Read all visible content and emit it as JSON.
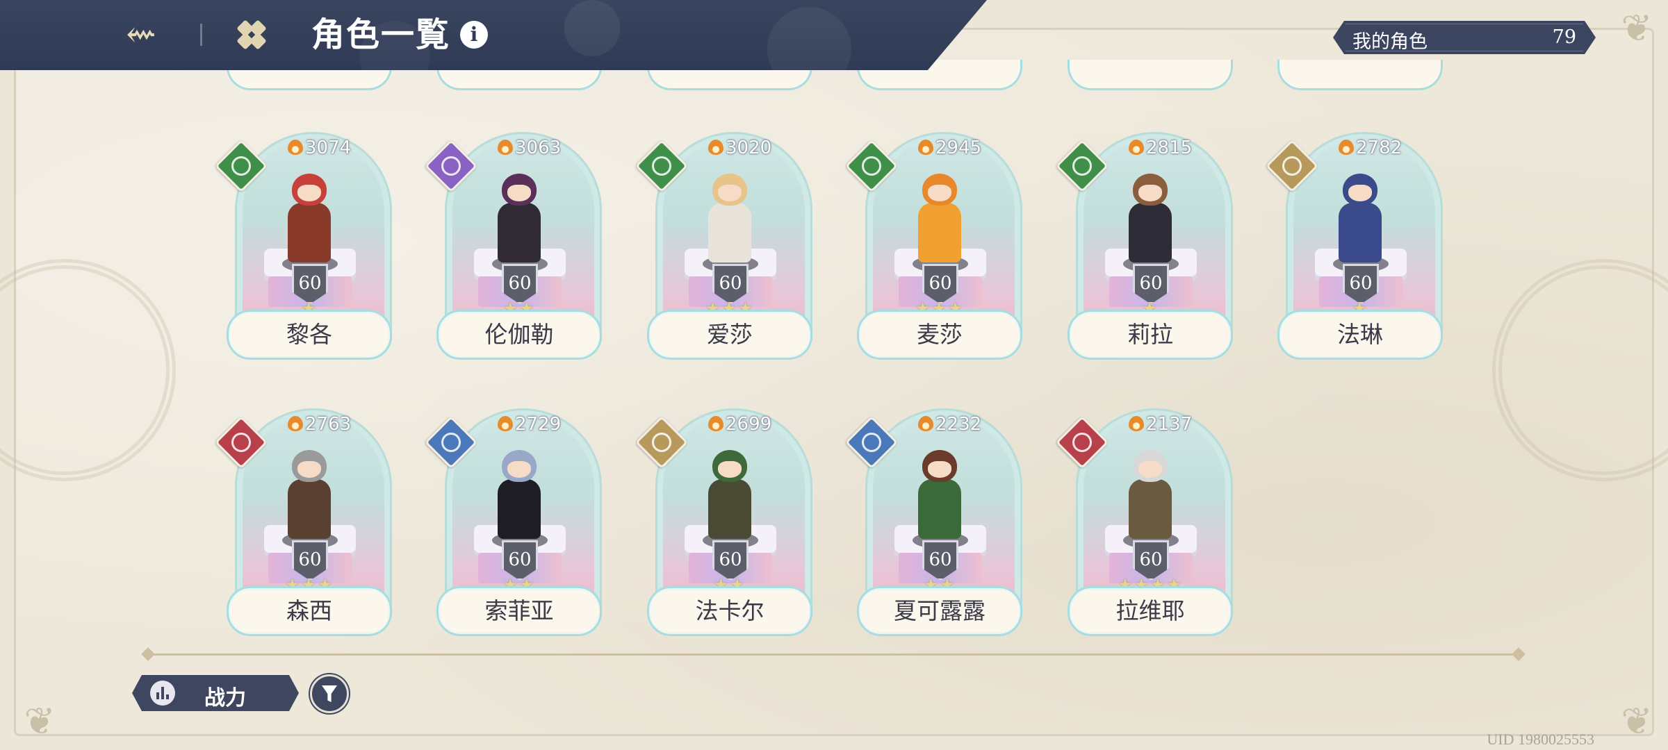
{
  "header": {
    "title": "角色一覧",
    "info_symbol": "i",
    "back_icon": "back-arrow-icon",
    "menu_icon": "grid-menu-icon",
    "my_characters_label": "我的角色",
    "my_characters_count": "79"
  },
  "colors": {
    "header_bg": "#2f3a55",
    "badge_green": "#3f8f4a",
    "badge_purple": "#8a62c4",
    "badge_gold": "#b8995c",
    "badge_red": "#b8404a",
    "badge_blue": "#4a78b8",
    "card_border": "#a8dde0"
  },
  "characters": [
    {
      "name": "黎各",
      "power": "3074",
      "level": "60",
      "stars": "★",
      "class_color": "#3f8f4a",
      "hair": "#c8403a",
      "outfit": "#8a3a2a"
    },
    {
      "name": "伦伽勒",
      "power": "3063",
      "level": "60",
      "stars": "★★",
      "class_color": "#8a62c4",
      "hair": "#5a2f5a",
      "outfit": "#2f2a34"
    },
    {
      "name": "爱莎",
      "power": "3020",
      "level": "60",
      "stars": "★★★",
      "class_color": "#3f8f4a",
      "hair": "#e6c48a",
      "outfit": "#e8e4dc"
    },
    {
      "name": "麦莎",
      "power": "2945",
      "level": "60",
      "stars": "★★★",
      "class_color": "#3f8f4a",
      "hair": "#e8882a",
      "outfit": "#f0a030"
    },
    {
      "name": "莉拉",
      "power": "2815",
      "level": "60",
      "stars": "★",
      "class_color": "#3f8f4a",
      "hair": "#8a5e3c",
      "outfit": "#2e2c36"
    },
    {
      "name": "法琳",
      "power": "2782",
      "level": "60",
      "stars": "★",
      "class_color": "#b8995c",
      "hair": "#3a4a8a",
      "outfit": "#3a4a8a"
    },
    {
      "name": "森西",
      "power": "2763",
      "level": "60",
      "stars": "★★★",
      "class_color": "#b8404a",
      "hair": "#9a9a9a",
      "outfit": "#5a4030"
    },
    {
      "name": "索菲亚",
      "power": "2729",
      "level": "60",
      "stars": "★★",
      "class_color": "#4a78b8",
      "hair": "#9aa8c8",
      "outfit": "#1e1c24"
    },
    {
      "name": "法卡尔",
      "power": "2699",
      "level": "60",
      "stars": "★★",
      "class_color": "#b8995c",
      "hair": "#3e6a3a",
      "outfit": "#4a4a34"
    },
    {
      "name": "夏可露露",
      "power": "2232",
      "level": "60",
      "stars": "★★",
      "class_color": "#4a78b8",
      "hair": "#6a3a2a",
      "outfit": "#3a6a3a"
    },
    {
      "name": "拉维耶",
      "power": "2137",
      "level": "60",
      "stars": "★★★★",
      "class_color": "#b8404a",
      "hair": "#d8d8d8",
      "outfit": "#6a5a40"
    }
  ],
  "footer": {
    "sort_label": "战力",
    "sort_icon": "bar-chart-icon",
    "filter_icon": "filter-icon",
    "uid": "UID 1980025553"
  }
}
